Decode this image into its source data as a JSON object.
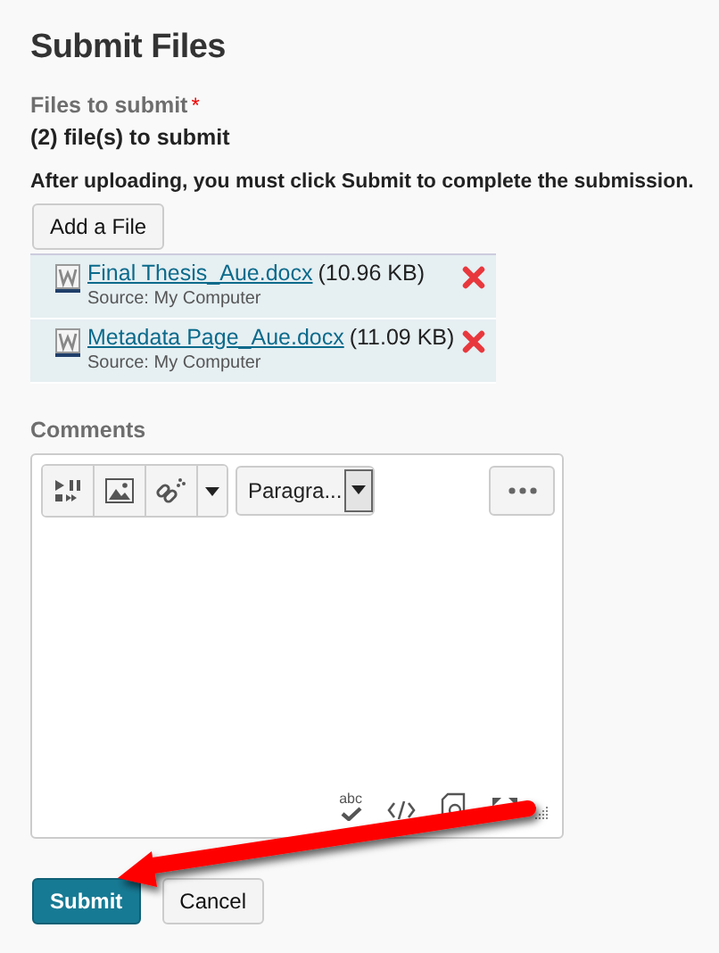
{
  "title": "Submit Files",
  "files_label": "Files to submit",
  "required_mark": "*",
  "files_count": "(2) file(s) to submit",
  "instruction": "After uploading, you must click Submit to complete the submission.",
  "add_button": "Add a File",
  "files": [
    {
      "name": "Final Thesis_Aue.docx",
      "size": "(10.96 KB)",
      "source": "Source: My Computer"
    },
    {
      "name": "Metadata Page_Aue.docx",
      "size": "(11.09 KB)",
      "source": "Source: My Computer"
    }
  ],
  "comments_label": "Comments",
  "editor": {
    "format": "Paragra...",
    "spellcheck_label": "abc"
  },
  "buttons": [
    {
      "label": "Submit",
      "kind": "primary"
    },
    {
      "label": "Cancel",
      "kind": "secondary"
    }
  ]
}
